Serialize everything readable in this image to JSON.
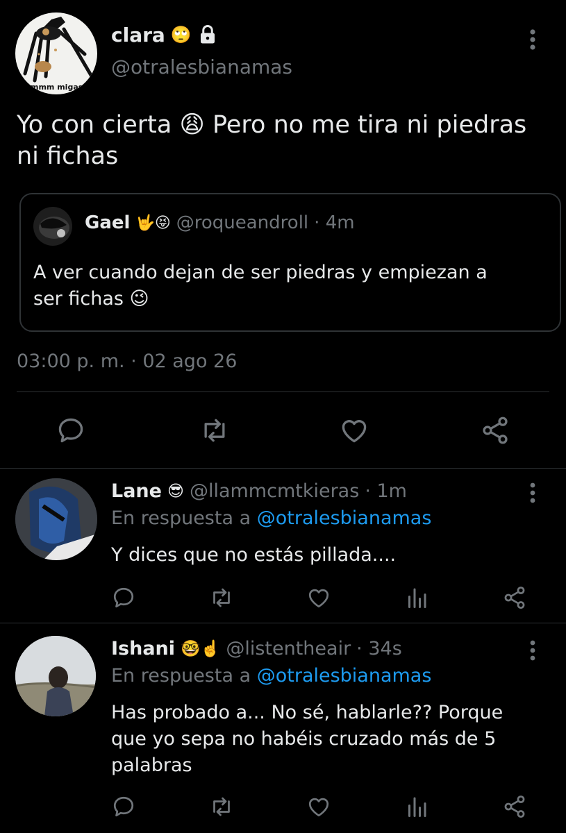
{
  "main_tweet": {
    "name": "clara",
    "name_emojis": "🙄",
    "handle": "@otralesbianamas",
    "avatar_caption": "mmm migas",
    "text": "Yo con cierta 😩 Pero no me tira ni piedras ni fichas",
    "text_line1": "Yo con cierta 😩 Pero no me tira ni piedras",
    "text_line2": "ni fichas",
    "timestamp": "03:00 p. m. · 02 ago 26",
    "quoted": {
      "name": "Gael",
      "name_emojis": "🤟😝",
      "handle": "@roqueandroll",
      "time": "· 4m",
      "text_line1": "A ver cuando dejan de ser piedras y empiezan a",
      "text_line2": "ser fichas 😉"
    }
  },
  "replies": [
    {
      "name": "Lane",
      "name_emojis": "😎",
      "handle": "@llammcmtkieras",
      "time": "· 1m",
      "reply_prefix": "En respuesta a",
      "reply_to": "@otralesbianamas",
      "text_lines": [
        "Y dices que no estás pillada...."
      ]
    },
    {
      "name": "Ishani",
      "name_emojis": "🤓☝️",
      "handle": "@listentheair",
      "time": "· 34s",
      "reply_prefix": "En respuesta a",
      "reply_to": "@otralesbianamas",
      "text_lines": [
        "Has probado a... No sé, hablarle?? Porque",
        "que yo sepa no habéis cruzado más de 5",
        "palabras"
      ]
    }
  ],
  "icons": [
    "more-icon",
    "lock-icon",
    "reply-icon",
    "retweet-icon",
    "like-icon",
    "share-icon",
    "views-icon"
  ],
  "colors": {
    "background": "#000000",
    "text": "#e7e9ea",
    "muted": "#71767b",
    "link": "#1d9bf0",
    "divider": "#2f3336"
  }
}
